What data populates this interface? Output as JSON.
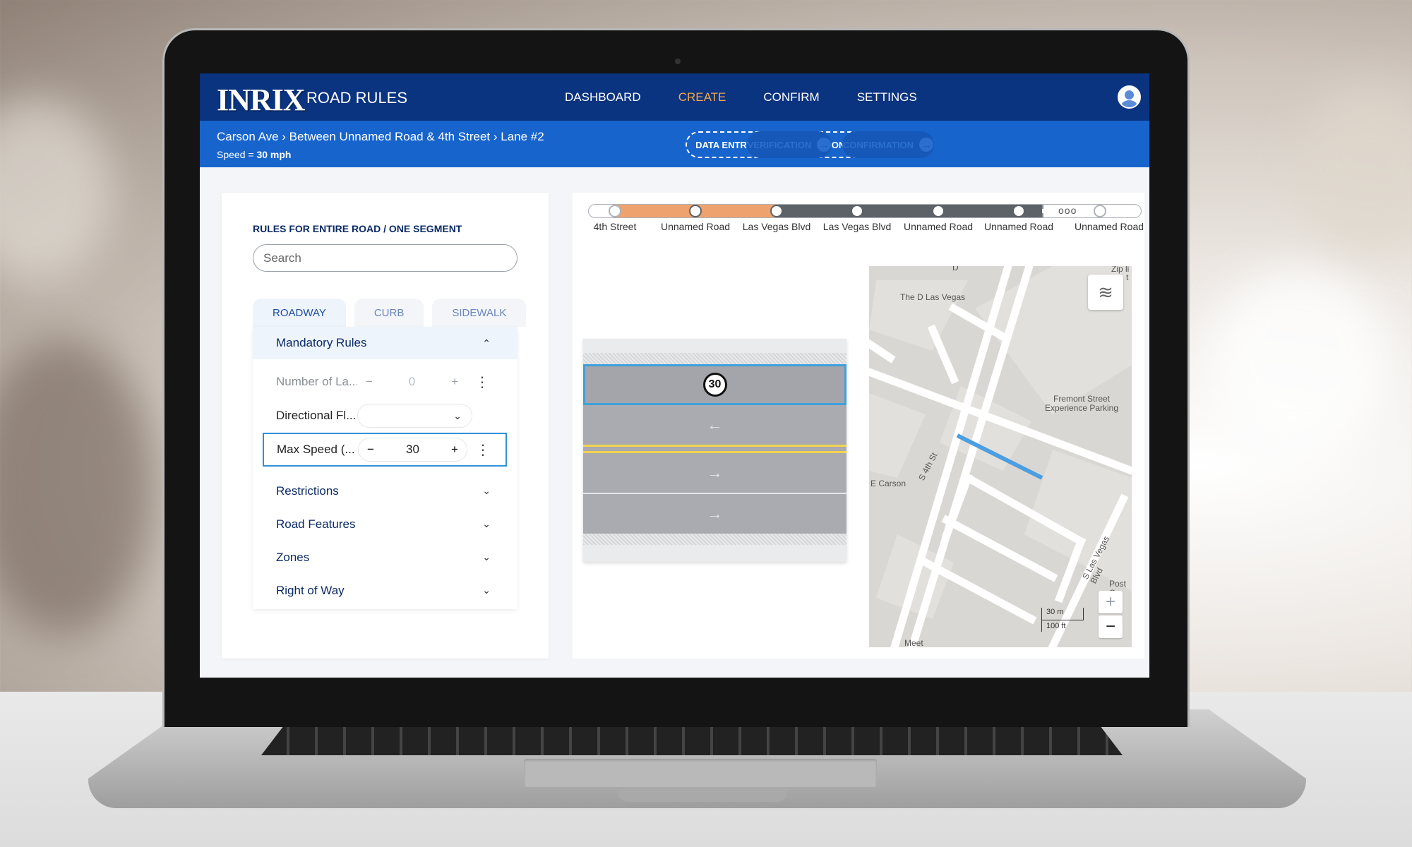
{
  "brand": {
    "logo": "INRIX",
    "product": "ROAD RULES"
  },
  "nav": [
    "DASHBOARD",
    "CREATE",
    "CONFIRM",
    "SETTINGS"
  ],
  "nav_active": "CREATE",
  "breadcrumb": "Carson Ave › Between Unnamed Road & 4th Street › Lane #2",
  "speed_prefix": "Speed = ",
  "speed_value": "30 mph",
  "steps": {
    "done": "DATA ENTRY FOR SEGMENT DONE",
    "verification": "VERIFICATION",
    "confirmation": "CONFIRMATION"
  },
  "panel": {
    "title": "RULES FOR ENTIRE ROAD / ONE SEGMENT",
    "search_placeholder": "Search",
    "tabs": [
      "ROADWAY",
      "CURB",
      "SIDEWALK"
    ],
    "active_tab": "ROADWAY",
    "mandatory_header": "Mandatory Rules",
    "rows": {
      "lanes_label": "Number of La...",
      "lanes_value": "0",
      "direction_label": "Directional Fl...",
      "maxspeed_label": "Max Speed (...",
      "maxspeed_value": "30"
    },
    "sections": [
      "Restrictions",
      "Road Features",
      "Zones",
      "Right of Way"
    ]
  },
  "segments": [
    "4th Street",
    "Unnamed Road",
    "Las Vegas Blvd",
    "Las Vegas Blvd",
    "Unnamed Road",
    "Unnamed Road",
    "Unnamed Road"
  ],
  "segment_progress_dots": "ooo",
  "lane_view": {
    "speed_sign": "30",
    "lane_arrows": [
      "←",
      "→",
      "→"
    ]
  },
  "map": {
    "labels": [
      "The D Las Vegas",
      "Fremont Street Experience Parking",
      "E Carson",
      "S 4th St",
      "S Las Vegas Blvd",
      "Post C",
      "Zip li",
      "Meet",
      "D",
      "t"
    ],
    "scale_m": "30 m",
    "scale_ft": "100 ft",
    "zoom_in": "+",
    "zoom_out": "−"
  },
  "icons": {
    "arrow": "→",
    "chevron_up": "⌃",
    "chevron_down": "⌄",
    "minus": "−",
    "plus": "+",
    "kebab": "⋮",
    "layers": "≋"
  },
  "colors": {
    "topbar": "#0a3380",
    "subbar": "#1764cc",
    "accent": "#f0a94b",
    "segment_fill": "#eea26d",
    "selection": "#3ea1dc"
  }
}
